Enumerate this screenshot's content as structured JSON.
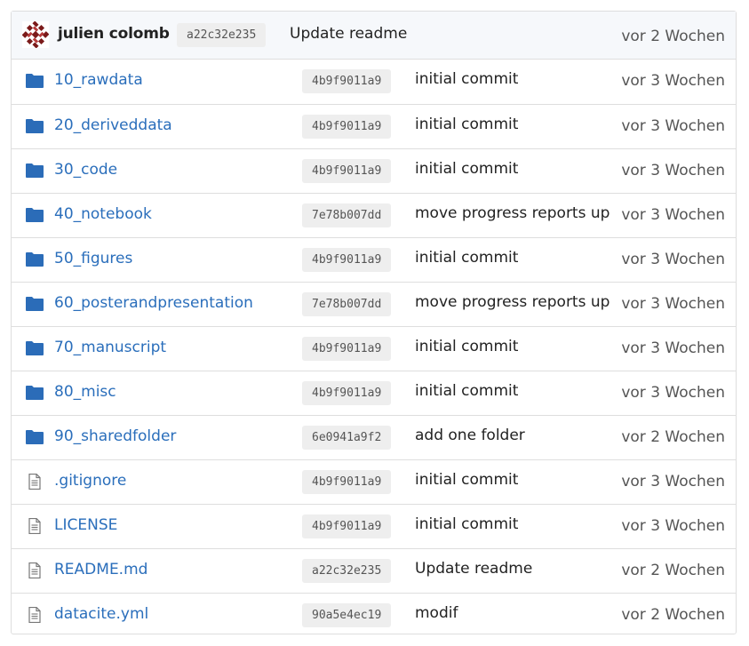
{
  "latest_commit": {
    "author": "julien colomb",
    "sha": "a22c32e235",
    "message": "Update readme",
    "age": "vor 2 Wochen"
  },
  "colors": {
    "link": "#2a6ebb",
    "folder_icon": "#2b6cb8",
    "file_icon": "#777777",
    "sha_bg": "#eeeeee",
    "header_bg": "#f6f8fb",
    "border": "#dedede"
  },
  "entries": [
    {
      "type": "folder",
      "icon": "folder-icon",
      "name": "10_rawdata",
      "sha": "4b9f9011a9",
      "message": "initial commit",
      "age": "vor 3 Wochen"
    },
    {
      "type": "folder",
      "icon": "folder-icon",
      "name": "20_deriveddata",
      "sha": "4b9f9011a9",
      "message": "initial commit",
      "age": "vor 3 Wochen"
    },
    {
      "type": "folder",
      "icon": "folder-icon",
      "name": "30_code",
      "sha": "4b9f9011a9",
      "message": "initial commit",
      "age": "vor 3 Wochen"
    },
    {
      "type": "folder",
      "icon": "folder-icon",
      "name": "40_notebook",
      "sha": "7e78b007dd",
      "message": "move progress reports up",
      "age": "vor 3 Wochen"
    },
    {
      "type": "folder",
      "icon": "folder-icon",
      "name": "50_figures",
      "sha": "4b9f9011a9",
      "message": "initial commit",
      "age": "vor 3 Wochen"
    },
    {
      "type": "folder",
      "icon": "folder-icon",
      "name": "60_posterandpresentation",
      "sha": "7e78b007dd",
      "message": "move progress reports up",
      "age": "vor 3 Wochen"
    },
    {
      "type": "folder",
      "icon": "folder-icon",
      "name": "70_manuscript",
      "sha": "4b9f9011a9",
      "message": "initial commit",
      "age": "vor 3 Wochen"
    },
    {
      "type": "folder",
      "icon": "folder-icon",
      "name": "80_misc",
      "sha": "4b9f9011a9",
      "message": "initial commit",
      "age": "vor 3 Wochen"
    },
    {
      "type": "folder",
      "icon": "folder-icon",
      "name": "90_sharedfolder",
      "sha": "6e0941a9f2",
      "message": "add one folder",
      "age": "vor 2 Wochen"
    },
    {
      "type": "file",
      "icon": "file-text-icon",
      "name": ".gitignore",
      "sha": "4b9f9011a9",
      "message": "initial commit",
      "age": "vor 3 Wochen"
    },
    {
      "type": "file",
      "icon": "file-text-icon",
      "name": "LICENSE",
      "sha": "4b9f9011a9",
      "message": "initial commit",
      "age": "vor 3 Wochen"
    },
    {
      "type": "file",
      "icon": "file-text-icon",
      "name": "README.md",
      "sha": "a22c32e235",
      "message": "Update readme",
      "age": "vor 2 Wochen"
    },
    {
      "type": "file",
      "icon": "file-text-icon",
      "name": "datacite.yml",
      "sha": "90a5e4ec19",
      "message": "modif",
      "age": "vor 2 Wochen"
    }
  ]
}
